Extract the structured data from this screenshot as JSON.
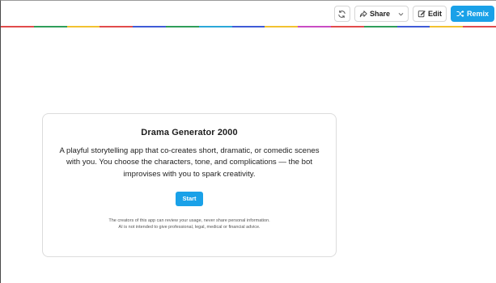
{
  "toolbar": {
    "share_label": "Share",
    "edit_label": "Edit",
    "remix_label": "Remix",
    "accent_color": "#1aa1e8"
  },
  "color_stripe": [
    "#e14b4b",
    "#2f9e5a",
    "#f2c230",
    "#e14b4b",
    "#3f5bd6",
    "#2f9e5a",
    "#2ba8d8",
    "#3f5bd6",
    "#f2c230",
    "#c94cc4",
    "#e14b4b",
    "#2f9e5a",
    "#3f5bd6",
    "#f2c230",
    "#e14b4b"
  ],
  "card": {
    "title": "Drama Generator 2000",
    "description": "A playful storytelling app that co-creates short, dramatic, or comedic scenes with you. You choose the characters, tone, and complications — the bot improvises with you to spark creativity.",
    "start_label": "Start",
    "disclaimer_line1": "The creators of this app can review your usage, never share personal information.",
    "disclaimer_line2": "AI is not intended to give professional, legal, medical or financial advice."
  },
  "icons": [
    "refresh-icon",
    "share-icon",
    "chevron-down-icon",
    "edit-icon",
    "remix-icon"
  ]
}
